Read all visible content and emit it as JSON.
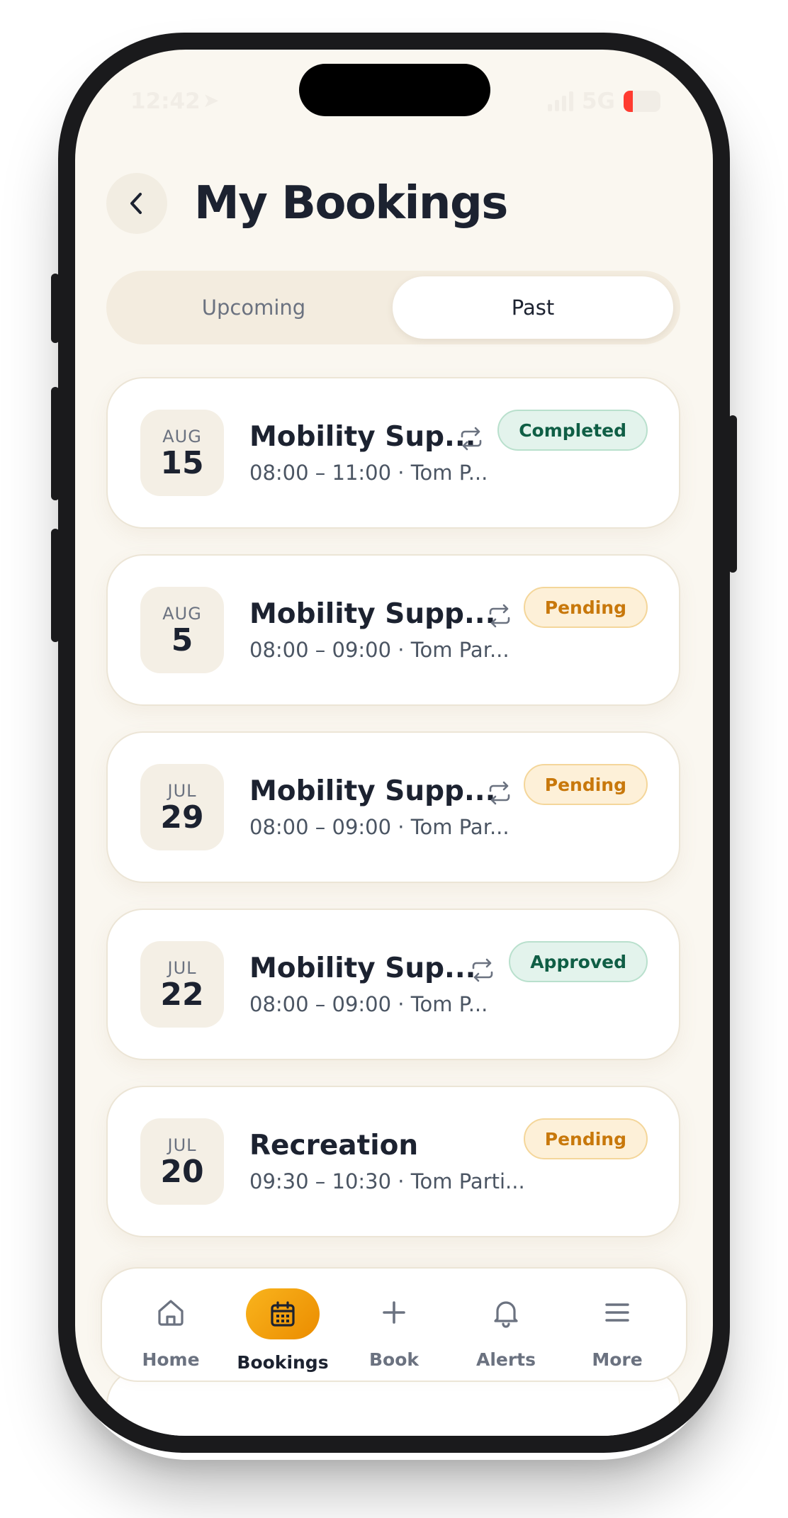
{
  "status_bar": {
    "time": "12:42",
    "network": "5G",
    "battery": "13"
  },
  "header": {
    "title": "My Bookings"
  },
  "tabs": [
    {
      "label": "Upcoming",
      "active": false
    },
    {
      "label": "Past",
      "active": true
    }
  ],
  "bookings": [
    {
      "month": "AUG",
      "day": "15",
      "title": "Mobility Sup...",
      "subtitle": "08:00 – 11:00 · Tom P...",
      "status": "Completed",
      "status_color": "green",
      "recurring": true
    },
    {
      "month": "AUG",
      "day": "5",
      "title": "Mobility Supp...",
      "subtitle": "08:00 – 09:00 · Tom Par...",
      "status": "Pending",
      "status_color": "amber",
      "recurring": true
    },
    {
      "month": "JUL",
      "day": "29",
      "title": "Mobility Supp...",
      "subtitle": "08:00 – 09:00 · Tom Par...",
      "status": "Pending",
      "status_color": "amber",
      "recurring": true
    },
    {
      "month": "JUL",
      "day": "22",
      "title": "Mobility Sup...",
      "subtitle": "08:00 – 09:00 · Tom P...",
      "status": "Approved",
      "status_color": "green",
      "recurring": true
    },
    {
      "month": "JUL",
      "day": "20",
      "title": "Recreation",
      "subtitle": "09:30 – 10:30 · Tom Parti...",
      "status": "Pending",
      "status_color": "amber",
      "recurring": false
    }
  ],
  "bottom_nav": [
    {
      "label": "Home",
      "icon": "home-icon",
      "active": false
    },
    {
      "label": "Bookings",
      "icon": "calendar-icon",
      "active": true
    },
    {
      "label": "Book",
      "icon": "plus-icon",
      "active": false
    },
    {
      "label": "Alerts",
      "icon": "bell-icon",
      "active": false
    },
    {
      "label": "More",
      "icon": "menu-icon",
      "active": false
    }
  ],
  "colors": {
    "accent": "#f5a511",
    "background": "#faf7f0",
    "text_primary": "#1c2230",
    "badge_green_text": "#0f5e45",
    "badge_amber_text": "#c8780b"
  }
}
